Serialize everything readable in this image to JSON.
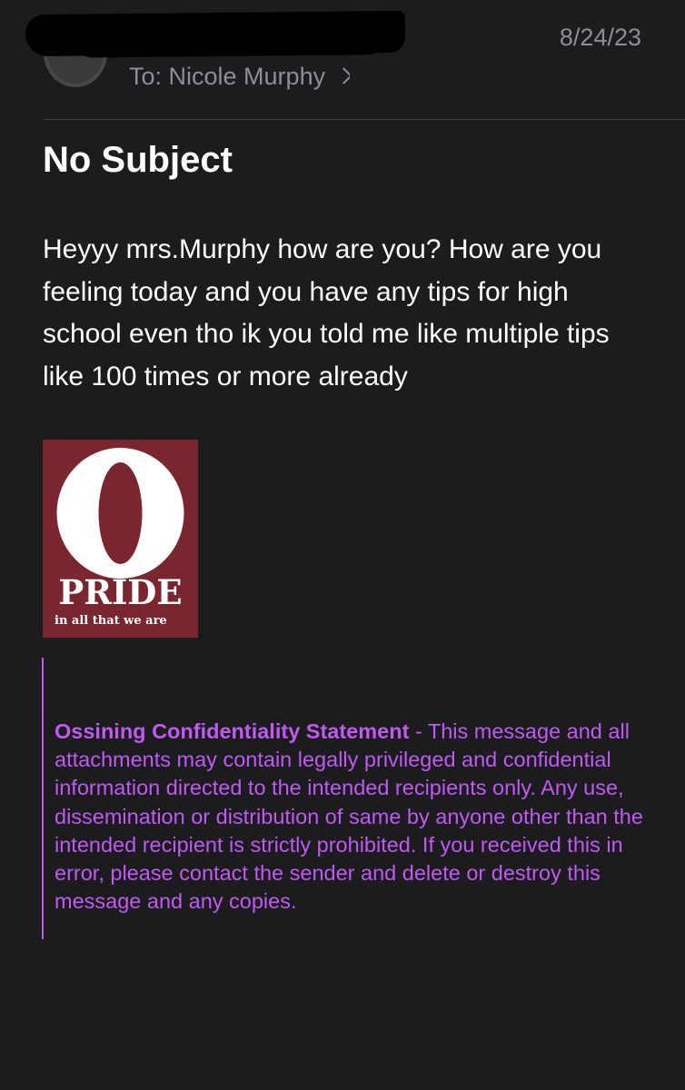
{
  "header": {
    "to_label": "To: Nicole Murphy",
    "date": "8/24/23"
  },
  "message": {
    "subject": "No Subject",
    "body": "Heyyy mrs.Murphy how are you? How are you feeling today and you have any tips for high school even tho ik you told me like multiple tips like 100 times or more already"
  },
  "signature_logo": {
    "letter": "O",
    "word": "PRIDE",
    "tagline": "in all that we are",
    "bg_color": "#7a2630"
  },
  "confidentiality": {
    "title": "Ossining Confidentiality Statement",
    "text": " - This message and all attachments may contain legally privileged and confidential information directed to the intended recipients only. Any use, dissemination or distribution of same by anyone other than the intended recipient is strictly prohibited. If you received this in error, please contact the sender and delete or destroy this message and any copies.",
    "color": "#bf5af2"
  },
  "colors": {
    "background": "#1c1c1e",
    "secondary_text": "#8e8e93"
  }
}
